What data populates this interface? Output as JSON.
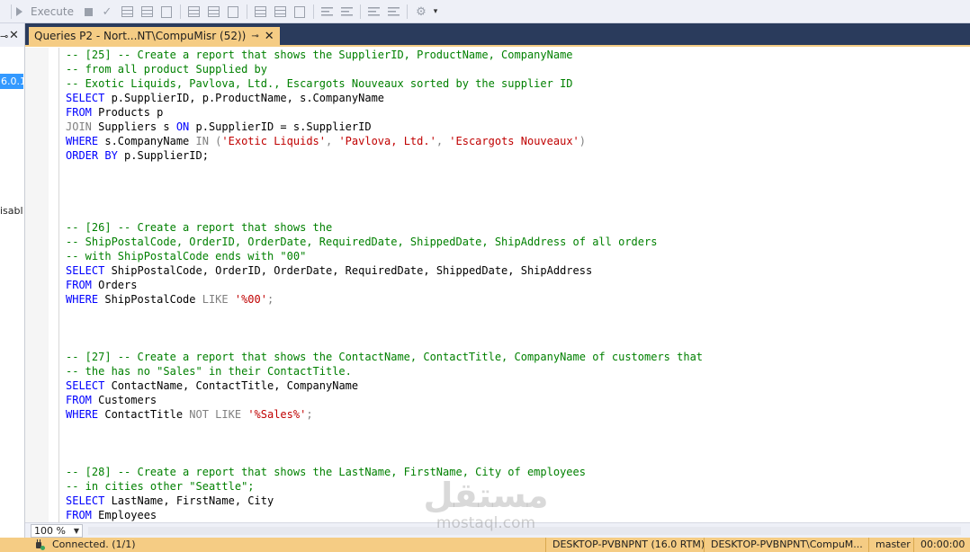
{
  "toolbar": {
    "execute_label": "Execute",
    "icons": [
      "execute-play-icon",
      "stop-icon",
      "parse-check-icon",
      "results-grid-icon",
      "results-text-icon",
      "results-file-icon",
      "include-plan-icon",
      "query-options-icon",
      "intellisense-icon",
      "comment-icon",
      "uncomment-icon",
      "indent-icon",
      "outdent-icon",
      "specify-values-icon",
      "dropdown-icon"
    ]
  },
  "left_panel": {
    "server_node_text": "6.0.1",
    "disabled_label": "isabl"
  },
  "tab": {
    "title": "Queries P2 - Nort...NT\\CompuMisr (52))",
    "pin_glyph": "⊸",
    "close_glyph": "✕"
  },
  "editor": {
    "lines": [
      [
        {
          "t": "-- [25] -- Create a report that shows the SupplierID, ProductName, CompanyName",
          "c": "cm"
        }
      ],
      [
        {
          "t": "-- from all product Supplied by",
          "c": "cm"
        }
      ],
      [
        {
          "t": "-- Exotic Liquids, Pavlova, Ltd., Escargots Nouveaux sorted by the supplier ID",
          "c": "cm"
        }
      ],
      [
        {
          "t": "SELECT",
          "c": "kw"
        },
        {
          "t": " p.SupplierID, p.ProductName, s.CompanyName",
          "c": ""
        }
      ],
      [
        {
          "t": "FROM",
          "c": "kw"
        },
        {
          "t": " Products p",
          "c": ""
        }
      ],
      [
        {
          "t": "JOIN",
          "c": "gr"
        },
        {
          "t": " Suppliers s ",
          "c": ""
        },
        {
          "t": "ON",
          "c": "kw"
        },
        {
          "t": " p.SupplierID = s.SupplierID",
          "c": ""
        }
      ],
      [
        {
          "t": "WHERE",
          "c": "kw"
        },
        {
          "t": " s.CompanyName ",
          "c": ""
        },
        {
          "t": "IN",
          "c": "gr"
        },
        {
          "t": " (",
          "c": "gr"
        },
        {
          "t": "'Exotic Liquids'",
          "c": "st"
        },
        {
          "t": ", ",
          "c": "gr"
        },
        {
          "t": "'Pavlova, Ltd.'",
          "c": "st"
        },
        {
          "t": ", ",
          "c": "gr"
        },
        {
          "t": "'Escargots Nouveaux'",
          "c": "st"
        },
        {
          "t": ")",
          "c": "gr"
        }
      ],
      [
        {
          "t": "ORDER BY",
          "c": "kw"
        },
        {
          "t": " p.SupplierID;",
          "c": ""
        }
      ],
      [],
      [],
      [],
      [],
      [
        {
          "t": "-- [26] -- Create a report that shows the",
          "c": "cm"
        }
      ],
      [
        {
          "t": "-- ShipPostalCode, OrderID, OrderDate, RequiredDate, ShippedDate, ShipAddress of all orders",
          "c": "cm"
        }
      ],
      [
        {
          "t": "-- with ShipPostalCode ends with \"00\"",
          "c": "cm"
        }
      ],
      [
        {
          "t": "SELECT",
          "c": "kw"
        },
        {
          "t": " ShipPostalCode, OrderID, OrderDate, RequiredDate, ShippedDate, ShipAddress",
          "c": ""
        }
      ],
      [
        {
          "t": "FROM",
          "c": "kw"
        },
        {
          "t": " Orders",
          "c": ""
        }
      ],
      [
        {
          "t": "WHERE",
          "c": "kw"
        },
        {
          "t": " ShipPostalCode ",
          "c": ""
        },
        {
          "t": "LIKE",
          "c": "gr"
        },
        {
          "t": " ",
          "c": ""
        },
        {
          "t": "'%00'",
          "c": "st"
        },
        {
          "t": ";",
          "c": "gr"
        }
      ],
      [],
      [],
      [],
      [
        {
          "t": "-- [27] -- Create a report that shows the ContactName, ContactTitle, CompanyName of customers that",
          "c": "cm"
        }
      ],
      [
        {
          "t": "-- the has no \"Sales\" in their ContactTitle.",
          "c": "cm"
        }
      ],
      [
        {
          "t": "SELECT",
          "c": "kw"
        },
        {
          "t": " ContactName, ContactTitle, CompanyName",
          "c": ""
        }
      ],
      [
        {
          "t": "FROM",
          "c": "kw"
        },
        {
          "t": " Customers",
          "c": ""
        }
      ],
      [
        {
          "t": "WHERE",
          "c": "kw"
        },
        {
          "t": " ContactTitle ",
          "c": ""
        },
        {
          "t": "NOT LIKE",
          "c": "gr"
        },
        {
          "t": " ",
          "c": ""
        },
        {
          "t": "'%Sales%'",
          "c": "st"
        },
        {
          "t": ";",
          "c": "gr"
        }
      ],
      [],
      [],
      [],
      [
        {
          "t": "-- [28] -- Create a report that shows the LastName, FirstName, City of employees",
          "c": "cm"
        }
      ],
      [
        {
          "t": "-- in cities other \"Seattle\";",
          "c": "cm"
        }
      ],
      [
        {
          "t": "SELECT",
          "c": "kw"
        },
        {
          "t": " LastName, FirstName, City",
          "c": ""
        }
      ],
      [
        {
          "t": "FROM",
          "c": "kw"
        },
        {
          "t": " Employees",
          "c": ""
        }
      ]
    ]
  },
  "zoom": {
    "value": "100 %"
  },
  "status_bar": {
    "connection": "Connected. (1/1)",
    "server": "DESKTOP-PVBNPNT (16.0 RTM)",
    "user": "DESKTOP-PVBNPNT\\CompuM...",
    "database": "master",
    "elapsed": "00:00:00"
  },
  "watermark": {
    "logo": "مستقل",
    "text": "mostaql.com"
  },
  "colors": {
    "tab_bar": "#2a3b5c",
    "active_tab": "#f5cc84",
    "status_bar": "#f5cc84",
    "comment": "#008000",
    "keyword": "#0000ff",
    "operator": "#808080",
    "string": "#c00000",
    "selection": "#3399ff"
  }
}
